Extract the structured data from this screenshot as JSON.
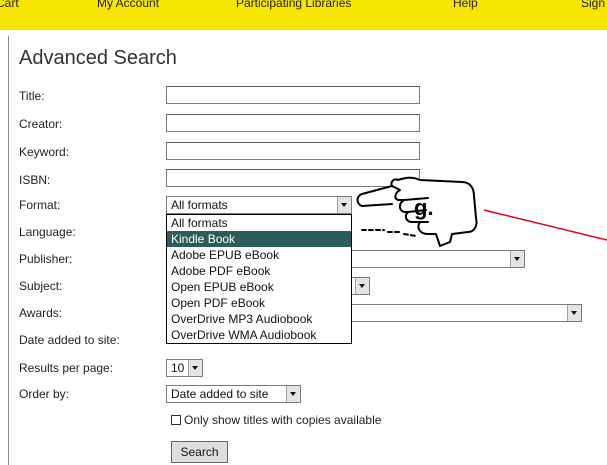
{
  "topnav": {
    "items": [
      {
        "label": "Cart"
      },
      {
        "label": "My Account"
      },
      {
        "label": "Participating Libraries"
      },
      {
        "label": "Help"
      },
      {
        "label": "Sign"
      }
    ]
  },
  "page": {
    "title": "Advanced Search"
  },
  "form": {
    "labels": {
      "title": "Title:",
      "creator": "Creator:",
      "keyword": "Keyword:",
      "isbn": "ISBN:",
      "format": "Format:",
      "language": "Language:",
      "publisher": "Publisher:",
      "subject": "Subject:",
      "awards": "Awards:",
      "date_added": "Date added to site:",
      "results_per_page": "Results per page:",
      "order_by": "Order by:"
    },
    "values": {
      "title": "",
      "creator": "",
      "keyword": "",
      "isbn": ""
    },
    "format": {
      "selected": "All formats",
      "options": [
        "All formats",
        "Kindle Book",
        "Adobe EPUB eBook",
        "Adobe PDF eBook",
        "Open EPUB eBook",
        "Open PDF eBook",
        "OverDrive MP3 Audiobook",
        "OverDrive WMA Audiobook"
      ],
      "highlighted": "Kindle Book"
    },
    "results_per_page": "10",
    "order_by": "Date added to site",
    "copies_checkbox": {
      "checked": false,
      "label": "Only show titles with copies available"
    },
    "search_button": "Search"
  },
  "annotation": {
    "label": "g.",
    "color": "#e8000b"
  }
}
